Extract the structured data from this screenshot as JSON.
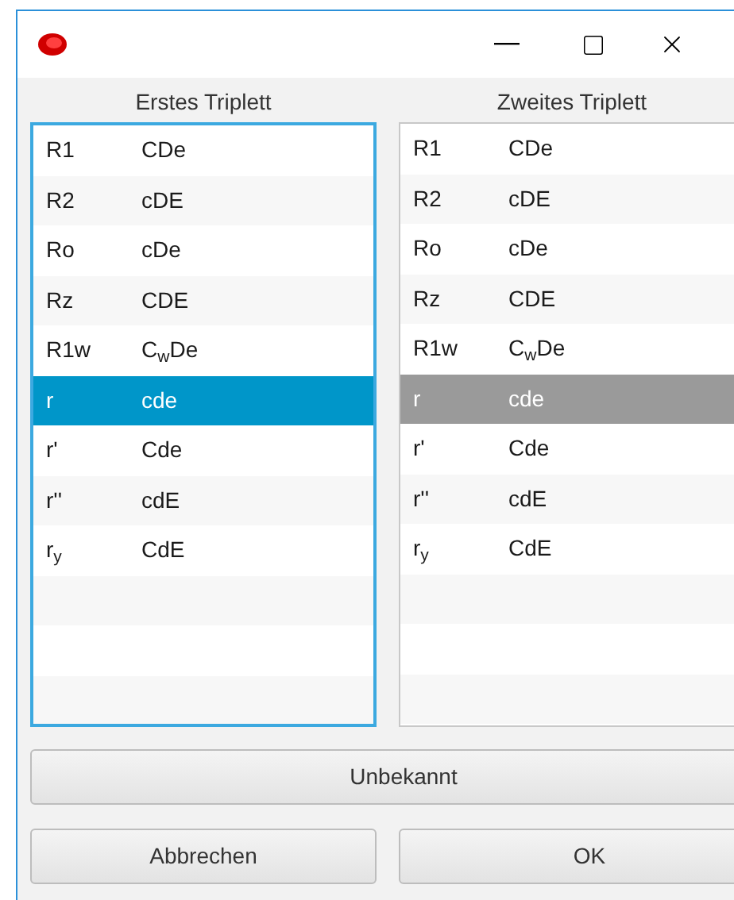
{
  "lists": [
    {
      "header": "Erstes Triplett",
      "focused": true,
      "rows": [
        {
          "code": "R1",
          "triplet": "CDe",
          "selected": false
        },
        {
          "code": "R2",
          "triplet": "cDE",
          "selected": false
        },
        {
          "code": "Ro",
          "triplet": "cDe",
          "selected": false
        },
        {
          "code": "Rz",
          "triplet": "CDE",
          "selected": false
        },
        {
          "code": "R1w",
          "triplet": "C$_{w}$De",
          "selected": false
        },
        {
          "code": "r",
          "triplet": "cde",
          "selected": true
        },
        {
          "code": "r'",
          "triplet": "Cde",
          "selected": false
        },
        {
          "code": "r''",
          "triplet": "cdE",
          "selected": false
        },
        {
          "code": "r$_{y}$",
          "triplet": "CdE",
          "selected": false
        }
      ]
    },
    {
      "header": "Zweites Triplett",
      "focused": false,
      "rows": [
        {
          "code": "R1",
          "triplet": "CDe",
          "selected": false
        },
        {
          "code": "R2",
          "triplet": "cDE",
          "selected": false
        },
        {
          "code": "Ro",
          "triplet": "cDe",
          "selected": false
        },
        {
          "code": "Rz",
          "triplet": "CDE",
          "selected": false
        },
        {
          "code": "R1w",
          "triplet": "C$_{w}$De",
          "selected": false
        },
        {
          "code": "r",
          "triplet": "cde",
          "selected": true
        },
        {
          "code": "r'",
          "triplet": "Cde",
          "selected": false
        },
        {
          "code": "r''",
          "triplet": "cdE",
          "selected": false
        },
        {
          "code": "r$_{y}$",
          "triplet": "CdE",
          "selected": false
        }
      ]
    }
  ],
  "unknown_button": "Unbekannt",
  "buttons": [
    "Abbrechen",
    "OK"
  ]
}
